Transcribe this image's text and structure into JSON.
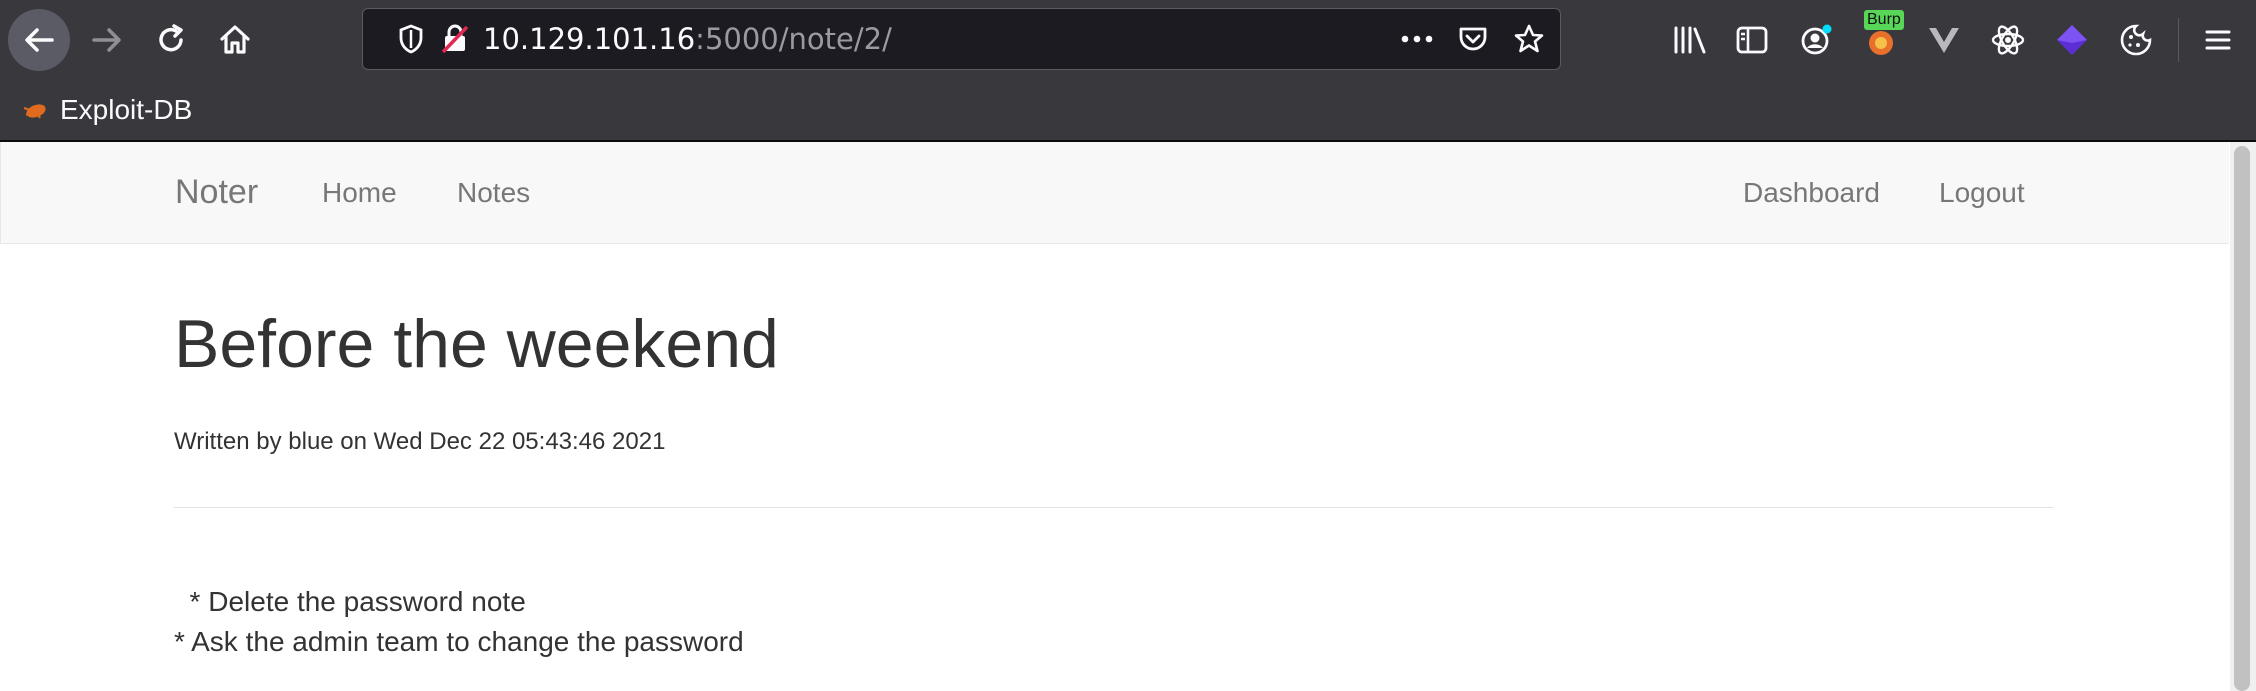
{
  "browser": {
    "url_host": "10.129.101.16",
    "url_rest": ":5000/note/2/",
    "bookmark_label": "Exploit-DB",
    "burp_badge": "Burp"
  },
  "navbar": {
    "brand": "Noter",
    "home": "Home",
    "notes": "Notes",
    "dashboard": "Dashboard",
    "logout": "Logout"
  },
  "note": {
    "title": "Before the weekend",
    "meta": "Written by blue on Wed Dec 22 05:43:46 2021",
    "lines": [
      "  * Delete the password note",
      "* Ask the admin team to change the password"
    ]
  }
}
